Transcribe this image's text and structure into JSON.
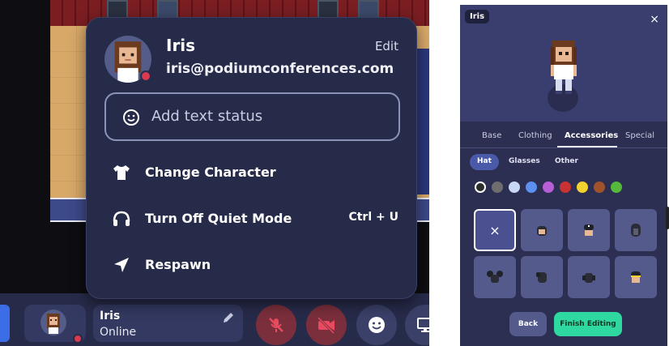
{
  "bottom_bar": {
    "user_name": "Iris",
    "user_status": "Online"
  },
  "profile_menu": {
    "name": "Iris",
    "email": "iris@podiumconferences.com",
    "edit_label": "Edit",
    "status_placeholder": "Add text status",
    "items": [
      {
        "label": "Change Character",
        "icon": "shirt-icon",
        "shortcut": ""
      },
      {
        "label": "Turn Off Quiet Mode",
        "icon": "headphones-icon",
        "shortcut": "Ctrl + U"
      },
      {
        "label": "Respawn",
        "icon": "navigate-arrow-icon",
        "shortcut": ""
      }
    ]
  },
  "character_editor": {
    "name_chip": "Iris",
    "close_glyph": "×",
    "tabs": [
      "Base",
      "Clothing",
      "Accessories",
      "Special"
    ],
    "active_tab": "Accessories",
    "subtabs": [
      "Hat",
      "Glasses",
      "Other"
    ],
    "active_subtab": "Hat",
    "colors": [
      "#2a2d2a",
      "#6e6e6e",
      "#c7d7f4",
      "#5b8ff0",
      "#b75fd6",
      "#c83232",
      "#f2d230",
      "#a0522d",
      "#56b93c"
    ],
    "selected_color": "#2a2d2a",
    "items_none_glyph": "×",
    "back_label": "Back",
    "finish_label": "Finish Editing"
  },
  "colors": {
    "panel_bg": "#2c2f52",
    "menu_bg": "#272b4a",
    "accent_green": "#2fd8a0",
    "mute_red": "#d93a4f"
  }
}
